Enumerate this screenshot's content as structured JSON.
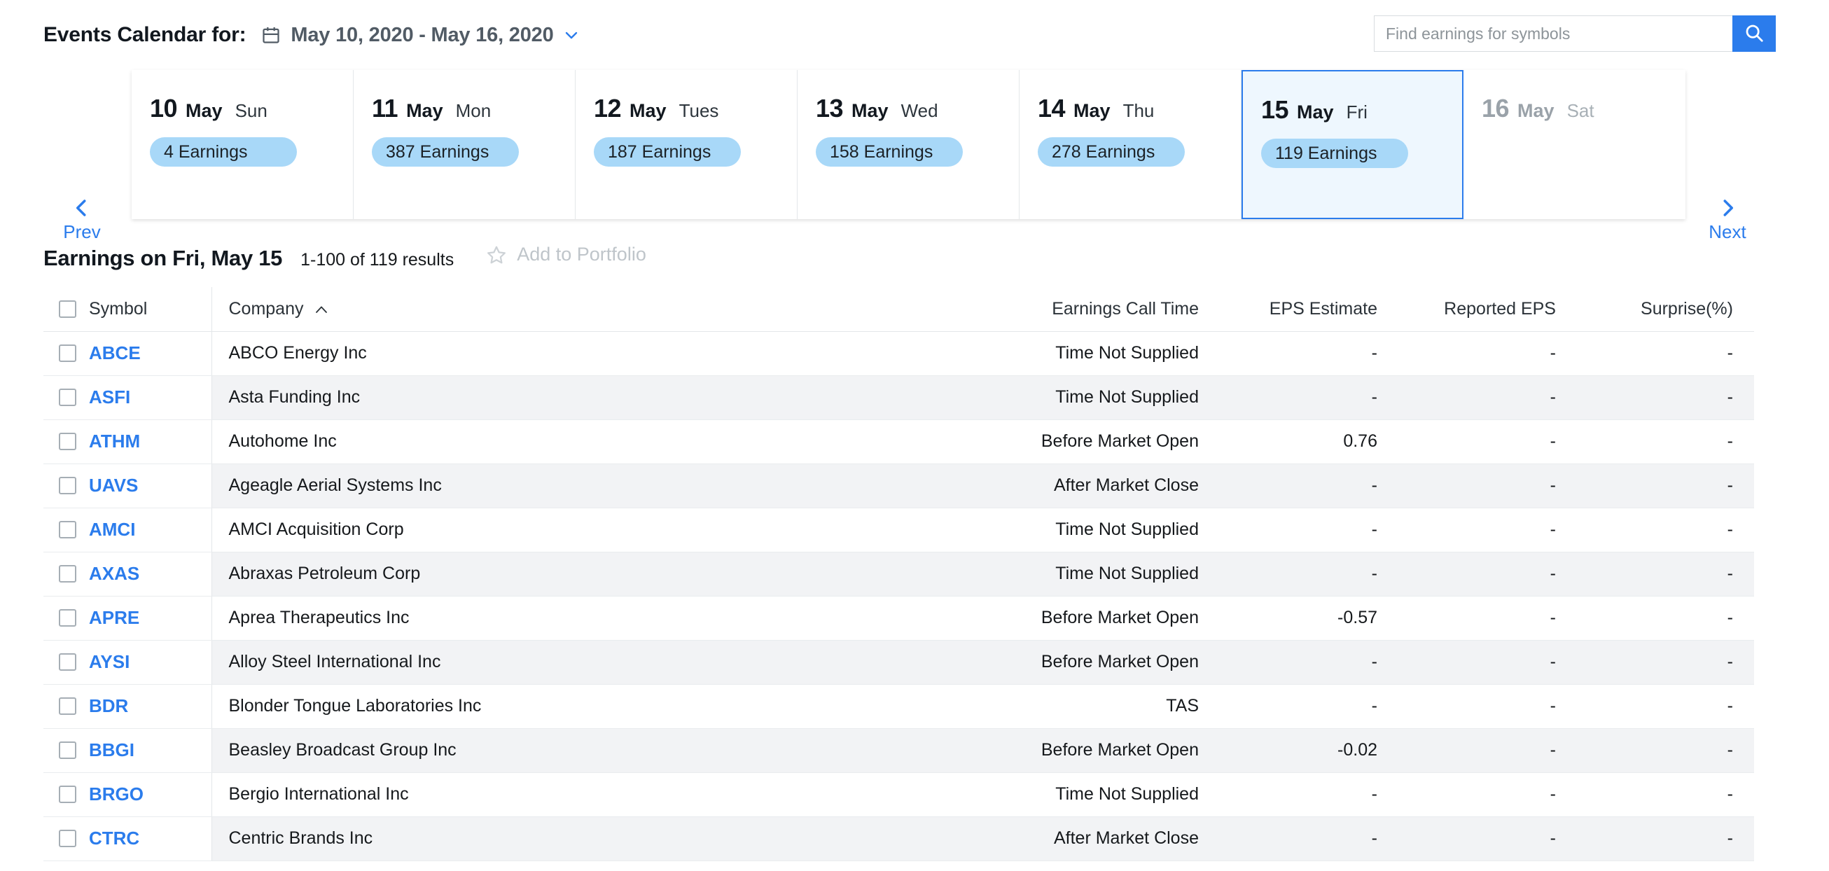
{
  "header": {
    "title": "Events Calendar for:",
    "date_range": "May 10, 2020 - May 16, 2020",
    "calendar_icon": "calendar-icon",
    "caret_icon": "chevron-down-icon"
  },
  "search": {
    "placeholder": "Find earnings for symbols",
    "value": "",
    "button_icon": "search-icon"
  },
  "week_nav": {
    "prev_label": "Prev",
    "next_label": "Next",
    "prev_icon": "chevron-left-icon",
    "next_icon": "chevron-right-icon"
  },
  "days": [
    {
      "num": "10",
      "month": "May",
      "dow": "Sun",
      "earnings": "4 Earnings",
      "selected": false,
      "disabled": false
    },
    {
      "num": "11",
      "month": "May",
      "dow": "Mon",
      "earnings": "387 Earnings",
      "selected": false,
      "disabled": false
    },
    {
      "num": "12",
      "month": "May",
      "dow": "Tues",
      "earnings": "187 Earnings",
      "selected": false,
      "disabled": false
    },
    {
      "num": "13",
      "month": "May",
      "dow": "Wed",
      "earnings": "158 Earnings",
      "selected": false,
      "disabled": false
    },
    {
      "num": "14",
      "month": "May",
      "dow": "Thu",
      "earnings": "278 Earnings",
      "selected": false,
      "disabled": false
    },
    {
      "num": "15",
      "month": "May",
      "dow": "Fri",
      "earnings": "119 Earnings",
      "selected": true,
      "disabled": false
    },
    {
      "num": "16",
      "month": "May",
      "dow": "Sat",
      "earnings": "",
      "selected": false,
      "disabled": true
    }
  ],
  "results": {
    "title": "Earnings on Fri, May 15",
    "count": "1-100 of 119 results",
    "add_to_portfolio": "Add to Portfolio",
    "star_icon": "star-icon"
  },
  "table": {
    "columns": {
      "symbol": "Symbol",
      "company": "Company",
      "call_time": "Earnings Call Time",
      "eps_estimate": "EPS Estimate",
      "reported_eps": "Reported EPS",
      "surprise": "Surprise(%)"
    },
    "sort_column": "company",
    "sort_direction": "asc",
    "sort_icon": "caret-up-icon",
    "rows": [
      {
        "symbol": "ABCE",
        "company": "ABCO Energy Inc",
        "call_time": "Time Not Supplied",
        "eps_estimate": "-",
        "reported_eps": "-",
        "surprise": "-"
      },
      {
        "symbol": "ASFI",
        "company": "Asta Funding Inc",
        "call_time": "Time Not Supplied",
        "eps_estimate": "-",
        "reported_eps": "-",
        "surprise": "-"
      },
      {
        "symbol": "ATHM",
        "company": "Autohome Inc",
        "call_time": "Before Market Open",
        "eps_estimate": "0.76",
        "reported_eps": "-",
        "surprise": "-"
      },
      {
        "symbol": "UAVS",
        "company": "Ageagle Aerial Systems Inc",
        "call_time": "After Market Close",
        "eps_estimate": "-",
        "reported_eps": "-",
        "surprise": "-"
      },
      {
        "symbol": "AMCI",
        "company": "AMCI Acquisition Corp",
        "call_time": "Time Not Supplied",
        "eps_estimate": "-",
        "reported_eps": "-",
        "surprise": "-"
      },
      {
        "symbol": "AXAS",
        "company": "Abraxas Petroleum Corp",
        "call_time": "Time Not Supplied",
        "eps_estimate": "-",
        "reported_eps": "-",
        "surprise": "-"
      },
      {
        "symbol": "APRE",
        "company": "Aprea Therapeutics Inc",
        "call_time": "Before Market Open",
        "eps_estimate": "-0.57",
        "reported_eps": "-",
        "surprise": "-"
      },
      {
        "symbol": "AYSI",
        "company": "Alloy Steel International Inc",
        "call_time": "Before Market Open",
        "eps_estimate": "-",
        "reported_eps": "-",
        "surprise": "-"
      },
      {
        "symbol": "BDR",
        "company": "Blonder Tongue Laboratories Inc",
        "call_time": "TAS",
        "eps_estimate": "-",
        "reported_eps": "-",
        "surprise": "-"
      },
      {
        "symbol": "BBGI",
        "company": "Beasley Broadcast Group Inc",
        "call_time": "Before Market Open",
        "eps_estimate": "-0.02",
        "reported_eps": "-",
        "surprise": "-"
      },
      {
        "symbol": "BRGO",
        "company": "Bergio International Inc",
        "call_time": "Time Not Supplied",
        "eps_estimate": "-",
        "reported_eps": "-",
        "surprise": "-"
      },
      {
        "symbol": "CTRC",
        "company": "Centric Brands Inc",
        "call_time": "After Market Close",
        "eps_estimate": "-",
        "reported_eps": "-",
        "surprise": "-"
      }
    ]
  },
  "colors": {
    "accent_blue": "#2b7cec",
    "badge_blue": "#a8d8f8",
    "selected_card_bg": "#eef7fe",
    "row_stripe": "#f2f3f5"
  }
}
